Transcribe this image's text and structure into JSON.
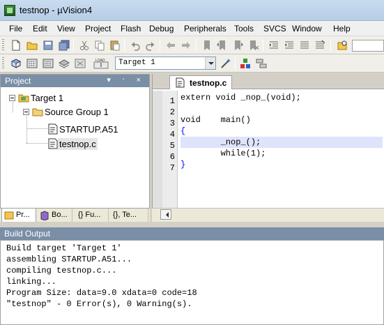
{
  "window": {
    "title": "testnop  - µVision4"
  },
  "menu": [
    "File",
    "Edit",
    "View",
    "Project",
    "Flash",
    "Debug",
    "Peripherals",
    "Tools",
    "SVCS",
    "Window",
    "Help"
  ],
  "toolbar2": {
    "target_value": "Target 1"
  },
  "project_panel": {
    "header": "Project",
    "header_icons": "▾ ᛫ ×",
    "tree": {
      "target": "Target 1",
      "group": "Source Group 1",
      "files": [
        "STARTUP.A51",
        "testnop.c"
      ],
      "selected_file": "testnop.c"
    },
    "tabs": [
      "Pr...",
      "Bo...",
      "{} Fu...",
      "{}, Te..."
    ]
  },
  "editor": {
    "tab_label": "testnop.c",
    "line_numbers": [
      "1",
      "2",
      "3",
      "4",
      "5",
      "6",
      "7"
    ],
    "lines": [
      "extern void _nop_(void);",
      "",
      "void    main()",
      "{",
      "        _nop_();",
      "        while(1);",
      "}"
    ],
    "current_line": 5
  },
  "build_output": {
    "header": "Build Output",
    "lines": [
      "Build target 'Target 1'",
      "assembling STARTUP.A51...",
      "compiling testnop.c...",
      "linking...",
      "Program Size: data=9.0 xdata=0 code=18",
      "\"testnop\" - 0 Error(s), 0 Warning(s)."
    ]
  },
  "colors": {
    "panel_header": "#7a8ea6",
    "current_line": "#dfe3fb",
    "brace": "#0000ff",
    "title_bar": "#c9dcef"
  },
  "icons": [
    "new-file-icon",
    "open-folder-icon",
    "save-icon",
    "save-all-icon",
    "cut-icon",
    "copy-icon",
    "paste-icon",
    "undo-icon",
    "redo-icon",
    "nav-back-icon",
    "nav-forward-icon",
    "bookmark-icon",
    "indent-icon",
    "find-icon",
    "translate-icon",
    "build-icon",
    "rebuild-icon",
    "batch-build-icon",
    "load-icon",
    "options-wand-icon",
    "manage-components-icon"
  ]
}
